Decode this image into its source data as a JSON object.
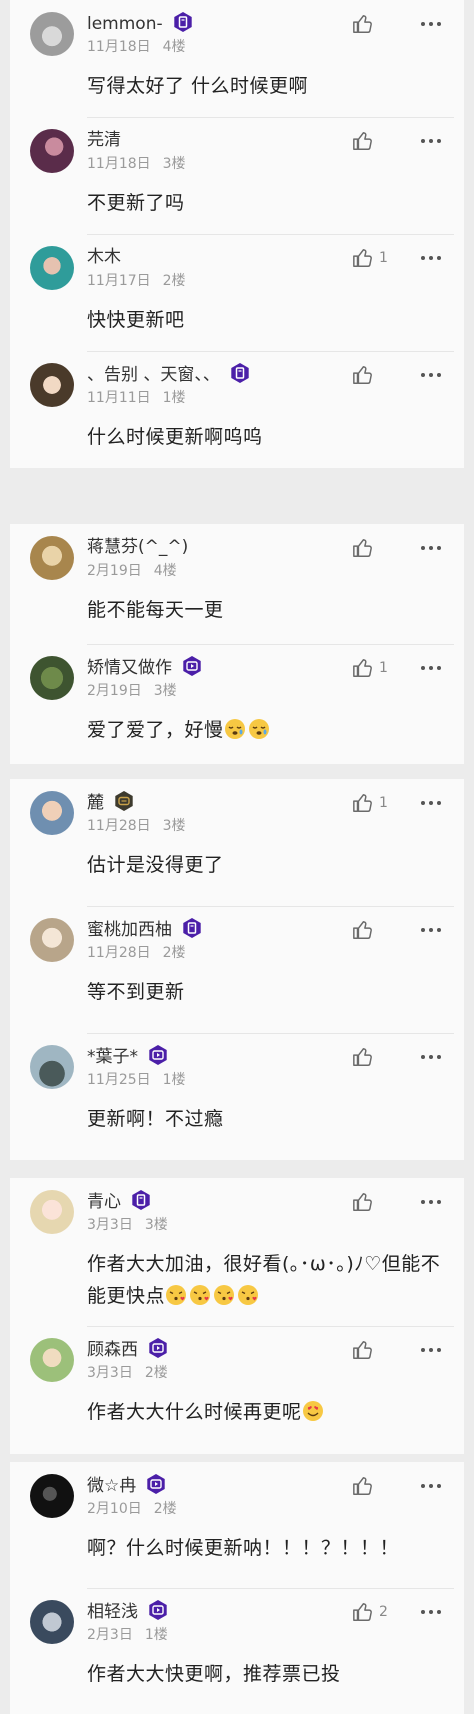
{
  "cards": [
    {
      "comments": [
        {
          "name": "lemmon-",
          "badge": "book-badge",
          "date": "11月18日",
          "floor": "4楼",
          "likes": "",
          "text": "写得太好了 什么时候更啊",
          "emojis": []
        },
        {
          "name": "芫清",
          "badge": "",
          "date": "11月18日",
          "floor": "3楼",
          "likes": "",
          "text": "不更新了吗",
          "emojis": []
        },
        {
          "name": "木木",
          "badge": "",
          "date": "11月17日",
          "floor": "2楼",
          "likes": "1",
          "text": "快快更新吧",
          "emojis": []
        },
        {
          "name": "、告别 、天窗、、",
          "badge": "book-badge",
          "date": "11月11日",
          "floor": "1楼",
          "likes": "",
          "text": "什么时候更新啊呜呜",
          "emojis": []
        }
      ]
    },
    {
      "comments": [
        {
          "name": "蒋慧芬(^_^)",
          "badge": "",
          "date": "2月19日",
          "floor": "4楼",
          "likes": "",
          "text": "能不能每天一更",
          "emojis": []
        },
        {
          "name": "矫情又做作",
          "badge": "play-badge",
          "date": "2月19日",
          "floor": "3楼",
          "likes": "1",
          "text": "爱了爱了，好慢",
          "emojis": [
            "sleepy-emoji",
            "sleepy-emoji"
          ]
        }
      ]
    },
    {
      "comments": [
        {
          "name": "麓",
          "badge": "chat-badge",
          "date": "11月28日",
          "floor": "3楼",
          "likes": "1",
          "text": "估计是没得更了",
          "emojis": []
        },
        {
          "name": "蜜桃加西柚",
          "badge": "book-badge",
          "date": "11月28日",
          "floor": "2楼",
          "likes": "",
          "text": "等不到更新",
          "emojis": []
        },
        {
          "name": "*葉子*",
          "badge": "play-badge",
          "date": "11月25日",
          "floor": "1楼",
          "likes": "",
          "text": "更新啊！不过瘾",
          "emojis": []
        }
      ]
    },
    {
      "comments": [
        {
          "name": "青心",
          "badge": "book-badge",
          "date": "3月3日",
          "floor": "3楼",
          "likes": "",
          "text": "作者大大加油，很好看(｡･ω･｡)ﾉ♡但能不能更快点",
          "emojis": [
            "kiss-emoji",
            "kiss-emoji",
            "kiss-emoji",
            "kiss-emoji"
          ]
        },
        {
          "name": "顾森西",
          "badge": "play-badge",
          "date": "3月3日",
          "floor": "2楼",
          "likes": "",
          "text": "作者大大什么时候再更呢",
          "emojis": [
            "heart-eyes-emoji"
          ]
        }
      ]
    },
    {
      "comments": [
        {
          "name": "微☆冉",
          "badge": "play-badge",
          "date": "2月10日",
          "floor": "2楼",
          "likes": "",
          "text": "啊？什么时候更新呐！！！？！！！",
          "emojis": []
        },
        {
          "name": "相轻浅",
          "badge": "play-badge",
          "date": "2月3日",
          "floor": "1楼",
          "likes": "2",
          "text": "作者大大快更啊，推荐票已投",
          "emojis": []
        }
      ]
    }
  ],
  "colors": {
    "badge_purple": "#4b1fa8",
    "badge_dark": "#3d3a2e",
    "badge_gold": "#c9a24a",
    "page_background": "#ececec",
    "card_background": "#fafafa"
  }
}
